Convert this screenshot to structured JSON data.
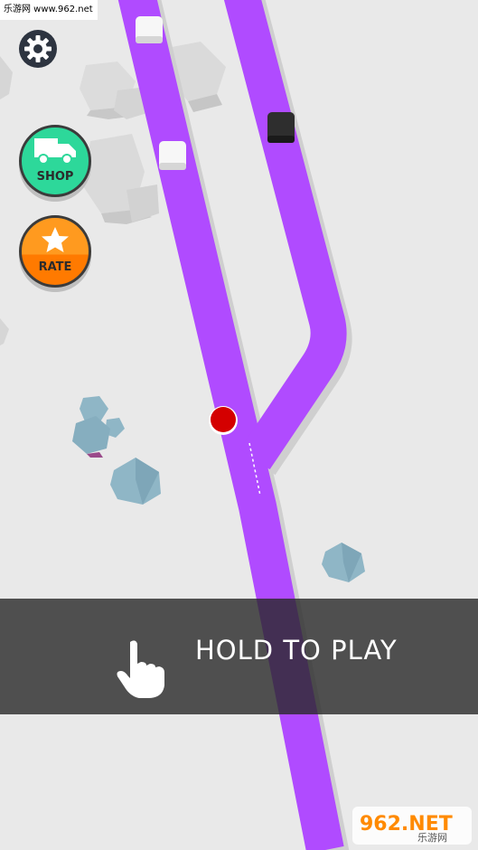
{
  "watermark_top": "乐游网 www.962.net",
  "buttons": {
    "shop_label": "SHOP",
    "rate_label": "RATE"
  },
  "banner": {
    "text": "HOLD TO PLAY",
    "icon": "tap-hand-icon"
  },
  "watermark_bottom": {
    "logo_text": "962.NET",
    "sub_text": "乐游网"
  },
  "colors": {
    "track": "#b04bff",
    "ball": "#d40000",
    "shop": "#2dd89a",
    "rate": "#ff8a00"
  },
  "icons": [
    "gear-icon",
    "truck-icon",
    "star-icon",
    "tap-hand-icon"
  ]
}
